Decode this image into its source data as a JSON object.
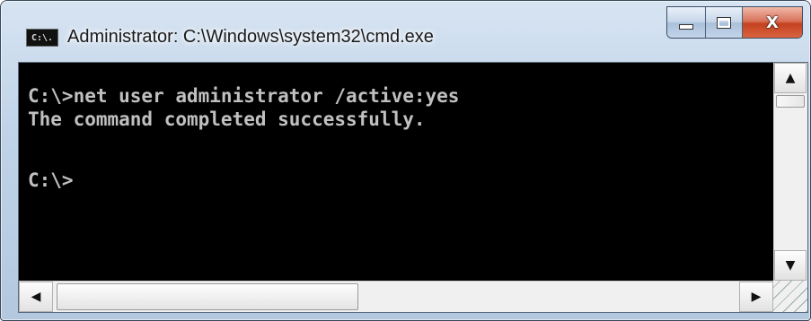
{
  "window": {
    "title": "Administrator: C:\\Windows\\system32\\cmd.exe",
    "app_icon_text": "C:\\."
  },
  "controls": {
    "minimize_icon": "minimize-icon",
    "maximize_icon": "maximize-icon",
    "close_icon": "close-icon",
    "close_glyph": "X"
  },
  "console": {
    "lines": [
      "C:\\>net user administrator /active:yes",
      "The command completed successfully.",
      "",
      "C:\\>"
    ],
    "background": "#000000",
    "foreground": "#c0c0c0"
  },
  "scrollbars": {
    "up_glyph": "▲",
    "down_glyph": "▼",
    "left_glyph": "◀",
    "right_glyph": "▶"
  },
  "colors": {
    "close_button": "#c4411f",
    "frame": "#c0d3e8"
  }
}
